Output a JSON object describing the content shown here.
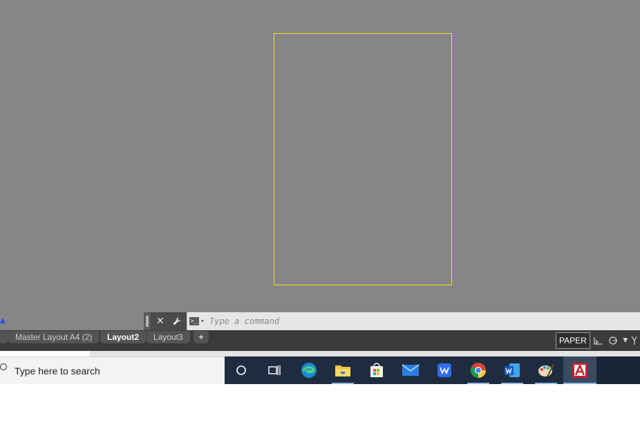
{
  "command_line": {
    "close_glyph": "✕",
    "customize_glyph": "🔧",
    "prompt_glyph": ">_",
    "placeholder": "Type a command"
  },
  "layout_tabs": [
    {
      "label": "Master Layout A4 (2)",
      "active": false
    },
    {
      "label": "Layout2",
      "active": true
    },
    {
      "label": "Layout3",
      "active": false
    }
  ],
  "add_tab_label": "+",
  "status": {
    "space_label": "PAPER"
  },
  "taskbar": {
    "search_placeholder": "Type here to search",
    "apps": [
      {
        "icon": "cortana-icon",
        "running": false
      },
      {
        "icon": "task-view-icon",
        "running": false
      },
      {
        "icon": "edge-icon",
        "running": false
      },
      {
        "icon": "file-explorer-icon",
        "running": true
      },
      {
        "icon": "microsoft-store-icon",
        "running": false
      },
      {
        "icon": "mail-icon",
        "running": false
      },
      {
        "icon": "wps-office-icon",
        "running": false
      },
      {
        "icon": "chrome-icon",
        "running": true
      },
      {
        "icon": "word-icon",
        "running": true
      },
      {
        "icon": "paint-icon",
        "running": true
      },
      {
        "icon": "autocad-icon",
        "running": true,
        "active": true
      }
    ]
  },
  "colors": {
    "canvas": "#868686",
    "paper_border": "#f2e41a",
    "taskbar": "#1f2c3f",
    "ucs": "#1f4bff"
  }
}
